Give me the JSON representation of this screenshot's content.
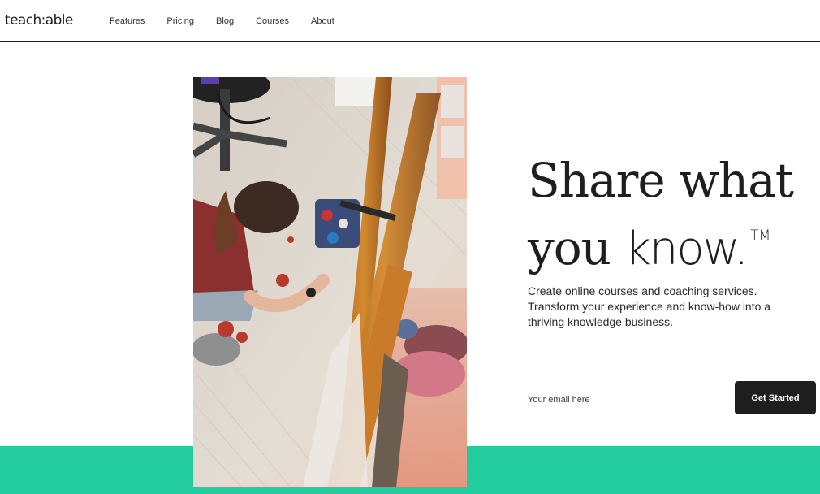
{
  "header": {
    "logo": "teach:able",
    "nav": [
      {
        "label": "Features"
      },
      {
        "label": "Pricing"
      },
      {
        "label": "Blog"
      },
      {
        "label": "Courses"
      },
      {
        "label": "About"
      }
    ]
  },
  "hero": {
    "headline_line1": "Share what",
    "headline_line2_prefix": "you ",
    "headline_emphasis": "know.",
    "trademark": "TM",
    "subtext": "Create online courses and coaching services. Transform your experience and know-how into a thriving knowledge business.",
    "email": {
      "value": "",
      "placeholder": "Your email here"
    },
    "cta_label": "Get Started",
    "image_alt": "Artist kneeling on the floor painting beside a wooden easel"
  },
  "colors": {
    "brand_green": "#22cc9d",
    "button_dark": "#1e1e1e",
    "text_dark": "#1e1e1e"
  }
}
